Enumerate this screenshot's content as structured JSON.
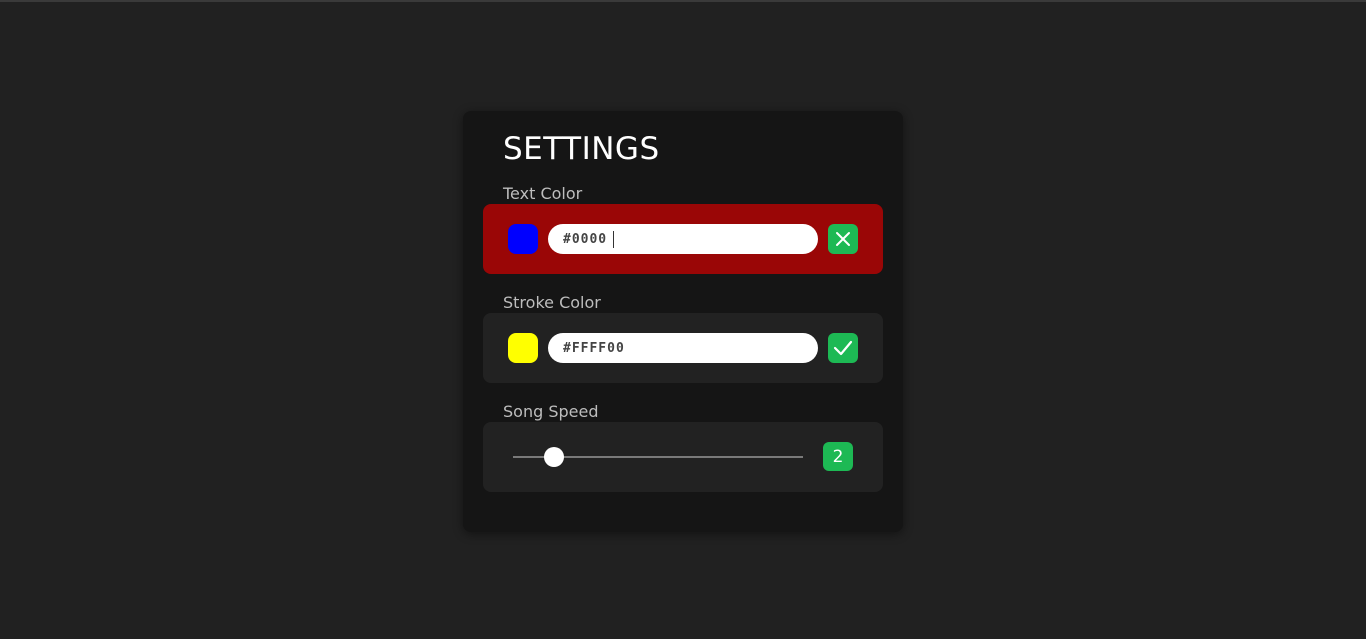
{
  "settings": {
    "title": "SETTINGS",
    "text_color": {
      "label": "Text Color",
      "value": "#0000",
      "swatch_color": "#0000ff",
      "status": "invalid",
      "action_icon": "close-icon",
      "row_color": "#9a0606"
    },
    "stroke_color": {
      "label": "Stroke Color",
      "value": "#FFFF00",
      "swatch_color": "#ffff00",
      "status": "valid",
      "action_icon": "check-icon"
    },
    "song_speed": {
      "label": "Song Speed",
      "value": "2",
      "slider_fraction": 0.14
    }
  },
  "colors": {
    "accent": "#1db954",
    "background": "#212121",
    "panel": "#151515",
    "row": "#222222"
  }
}
